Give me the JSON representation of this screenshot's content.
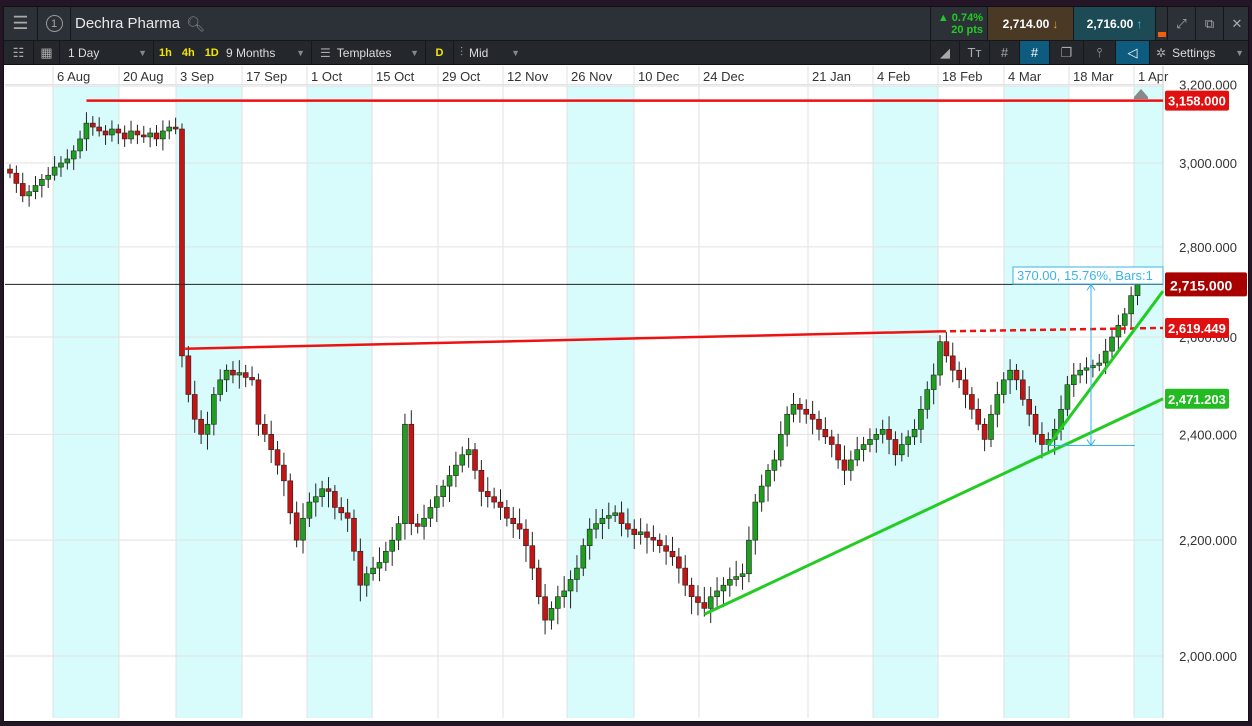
{
  "header": {
    "title": "Dechra Pharma",
    "instrument_index": "1",
    "change_pct": "▲ 0.74%",
    "change_pts": "20 pts",
    "sell_price": "2,714.00",
    "buy_price": "2,716.00"
  },
  "toolbar": {
    "interval": "1 Day",
    "quick": [
      "1h",
      "4h",
      "1D"
    ],
    "range": "9 Months",
    "templates": "Templates",
    "d_label": "D",
    "price_type": "Mid",
    "settings": "Settings"
  },
  "colors": {
    "up": "#1f9e1f",
    "down": "#c41414",
    "resistance": "#ee1111",
    "trend": "#22cc22",
    "band": "#d8fbfb",
    "measure": "#3ab4e8"
  },
  "chart_data": {
    "type": "candlestick",
    "title": "Dechra Pharma",
    "scale": "log",
    "ylim": [
      1920,
      3260
    ],
    "x_tick_labels": [
      "6 Aug",
      "20 Aug",
      "3 Sep",
      "17 Sep",
      "1 Oct",
      "15 Oct",
      "29 Oct",
      "12 Nov",
      "26 Nov",
      "10 Dec",
      "24 Dec",
      "21 Jan",
      "4 Feb",
      "18 Feb",
      "4 Mar",
      "18 Mar",
      "1 Apr"
    ],
    "y_tick_labels": [
      "3,200.000",
      "3,000.000",
      "2,800.000",
      "2,600.000",
      "2,400.000",
      "2,200.000",
      "2,000.000"
    ],
    "y_ticks": [
      3200,
      3000,
      2800,
      2600,
      2400,
      2200,
      2000
    ],
    "closes": [
      2975,
      2950,
      2920,
      2930,
      2945,
      2960,
      2970,
      2990,
      3000,
      3010,
      3030,
      3060,
      3100,
      3090,
      3080,
      3070,
      3085,
      3075,
      3060,
      3080,
      3070,
      3065,
      3075,
      3060,
      3080,
      3090,
      3085,
      2560,
      2480,
      2430,
      2400,
      2420,
      2480,
      2510,
      2530,
      2520,
      2525,
      2515,
      2510,
      2420,
      2400,
      2370,
      2340,
      2310,
      2250,
      2200,
      2240,
      2270,
      2280,
      2295,
      2290,
      2260,
      2250,
      2240,
      2180,
      2120,
      2140,
      2150,
      2160,
      2180,
      2200,
      2230,
      2420,
      2230,
      2225,
      2240,
      2260,
      2280,
      2300,
      2320,
      2340,
      2360,
      2370,
      2330,
      2290,
      2280,
      2270,
      2260,
      2240,
      2230,
      2220,
      2190,
      2150,
      2100,
      2060,
      2080,
      2100,
      2110,
      2130,
      2150,
      2190,
      2220,
      2230,
      2240,
      2245,
      2250,
      2230,
      2220,
      2210,
      2215,
      2205,
      2200,
      2190,
      2180,
      2170,
      2150,
      2120,
      2100,
      2090,
      2080,
      2100,
      2110,
      2120,
      2130,
      2135,
      2140,
      2200,
      2270,
      2300,
      2330,
      2350,
      2400,
      2440,
      2460,
      2450,
      2440,
      2430,
      2410,
      2395,
      2380,
      2350,
      2330,
      2350,
      2370,
      2380,
      2390,
      2400,
      2410,
      2390,
      2360,
      2380,
      2395,
      2410,
      2450,
      2490,
      2520,
      2590,
      2560,
      2530,
      2510,
      2480,
      2450,
      2420,
      2390,
      2440,
      2480,
      2510,
      2530,
      2510,
      2470,
      2440,
      2400,
      2380,
      2390,
      2410,
      2450,
      2500,
      2520,
      2530,
      2535,
      2540,
      2545,
      2570,
      2600,
      2625,
      2650,
      2690,
      2715
    ],
    "horizontal_line": {
      "value": 3158,
      "label": "3,158.000"
    },
    "resistance_trendline": {
      "from": [
        27.5,
        2575
      ],
      "to": [
        146,
        2612
      ],
      "right_value": 2619.449,
      "label": "2,619.449"
    },
    "support_trendlines": [
      {
        "from": [
          109,
          2070
        ],
        "right_value": 2471.203,
        "label": "2,471.203"
      },
      {
        "from": [
          163,
          2378
        ],
        "to": [
          177,
          2650
        ]
      }
    ],
    "current_price": {
      "value": 2715,
      "label": "2,715.000"
    },
    "measure": {
      "from": 2378,
      "to": 2715,
      "label": "370.00, 15.76%, Bars:1"
    }
  }
}
